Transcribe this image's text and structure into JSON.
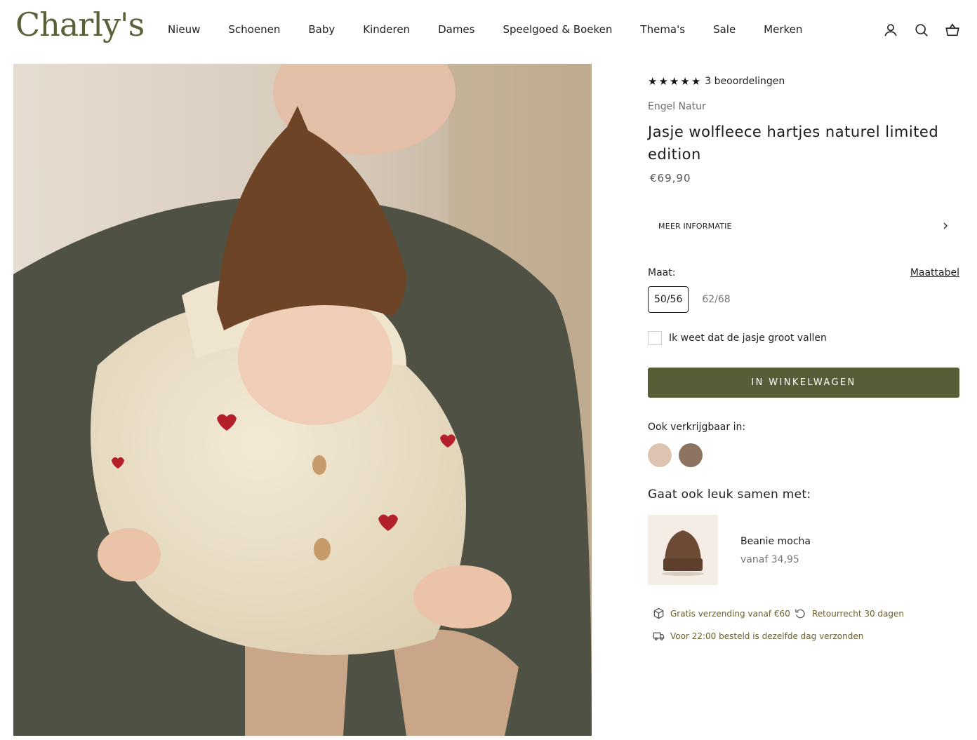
{
  "header": {
    "logo": "Charly's",
    "nav": [
      "Nieuw",
      "Schoenen",
      "Baby",
      "Kinderen",
      "Dames",
      "Speelgoed & Boeken",
      "Thema's",
      "Sale",
      "Merken"
    ],
    "icons": [
      "account-icon",
      "search-icon",
      "cart-icon"
    ]
  },
  "product": {
    "rating_count_label": "3 beoordelingen",
    "stars": 5,
    "brand": "Engel Natur",
    "title": "Jasje wolfleece hartjes naturel limited edition",
    "price": "€69,90",
    "more_info_label": "MEER INFORMATIE",
    "size_label": "Maat:",
    "size_chart_label": "Maattabel",
    "sizes": [
      "50/56",
      "62/68"
    ],
    "selected_size": "50/56",
    "checkbox_label": "Ik weet dat de jasje groot vallen",
    "add_to_cart_label": "IN WINKELWAGEN",
    "also_available_label": "Ook verkrijgbaar in:",
    "swatch_colors": [
      "#dcc4b0",
      "#8c7461"
    ],
    "pairs_label": "Gaat ook leuk samen met:",
    "pair": {
      "name": "Beanie mocha",
      "price": "vanaf 34,95"
    },
    "usps": [
      {
        "icon": "package-icon",
        "text": "Gratis verzending vanaf €60"
      },
      {
        "icon": "return-icon",
        "text": "Retourrecht 30 dagen"
      },
      {
        "icon": "truck-icon",
        "text": "Voor 22:00 besteld is dezelfde dag verzonden"
      }
    ]
  },
  "colors": {
    "brand_green": "#565e38",
    "logo_green": "#5a6138"
  }
}
